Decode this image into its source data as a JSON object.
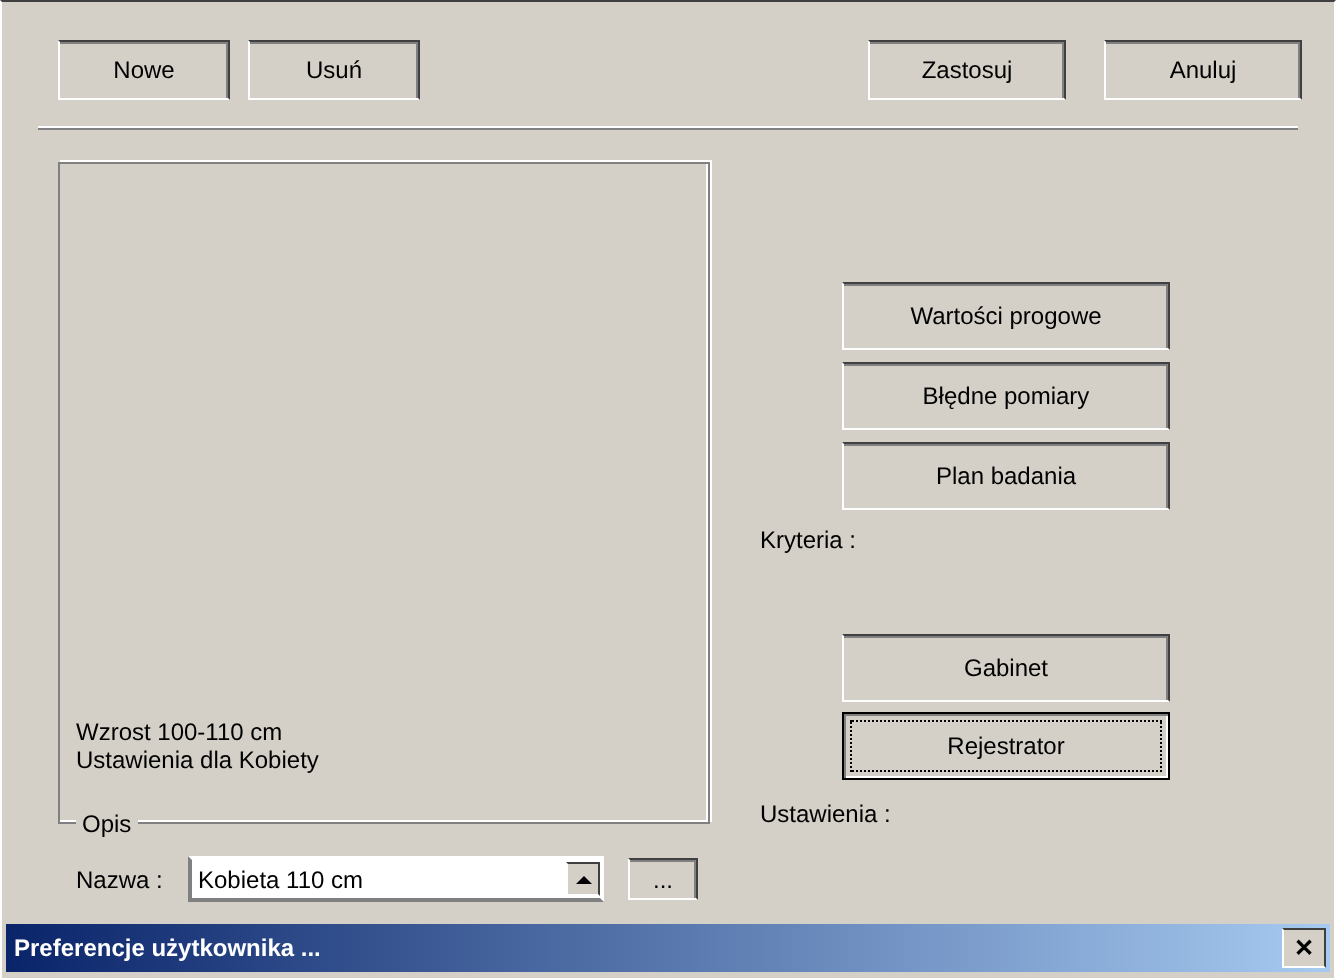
{
  "footer": {
    "left": [
      "Nowe",
      "Usuń"
    ],
    "right": [
      "Zastosuj",
      "Anuluj"
    ]
  },
  "criteria": {
    "buttons": [
      {
        "label": "Wartości progowe",
        "default": false
      },
      {
        "label": "Błędne pomiary",
        "default": false
      },
      {
        "label": "Plan badania",
        "default": false
      }
    ],
    "label": "Kryteria :"
  },
  "settings": {
    "buttons": [
      {
        "label": "Gabinet",
        "default": false
      },
      {
        "label": "Rejestrator",
        "default": true
      }
    ],
    "label": "Ustawienia :"
  },
  "description": {
    "lines": [
      "Wzrost 100-110 cm",
      "Ustawienia dla Kobiety"
    ],
    "legend": "Opis"
  },
  "name_row": {
    "label": "Nazwa :",
    "value": "Kobieta 110 cm",
    "browse": "..."
  },
  "window": {
    "title": "Preferencje użytkownika ...",
    "close": "✕"
  }
}
